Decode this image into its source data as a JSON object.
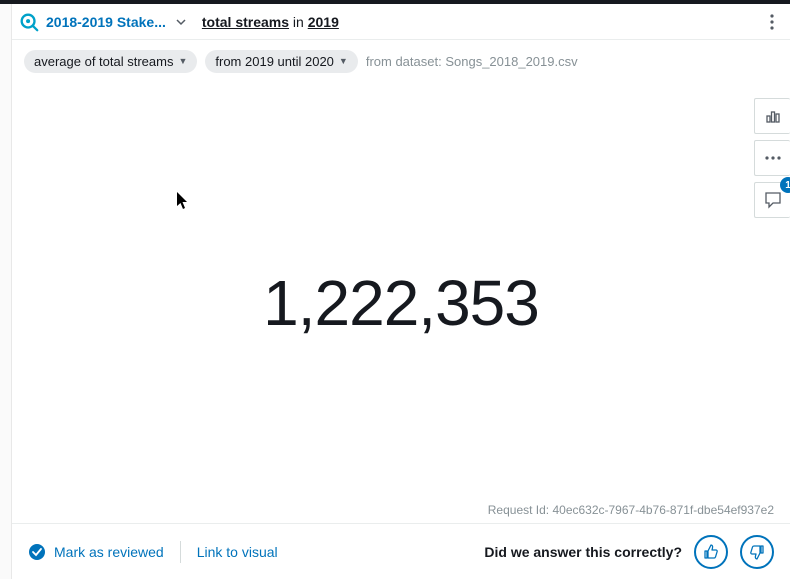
{
  "header": {
    "workspace_label": "2018-2019 Stake...",
    "query_metric": "total streams",
    "query_connector": " in ",
    "query_year": "2019"
  },
  "filters": {
    "pill1": "average of total streams",
    "pill2": "from 2019 until 2020",
    "dataset_prefix": "from dataset: ",
    "dataset_name": "Songs_2018_2019.csv"
  },
  "result": {
    "value": "1,222,353"
  },
  "right_tools": {
    "comment_badge": "1"
  },
  "request": {
    "label": "Request Id: ",
    "id": "40ec632c-7967-4b76-871f-dbe54ef937e2"
  },
  "footer": {
    "mark_reviewed": "Mark as reviewed",
    "link_visual": "Link to visual",
    "feedback_question": "Did we answer this correctly?"
  }
}
